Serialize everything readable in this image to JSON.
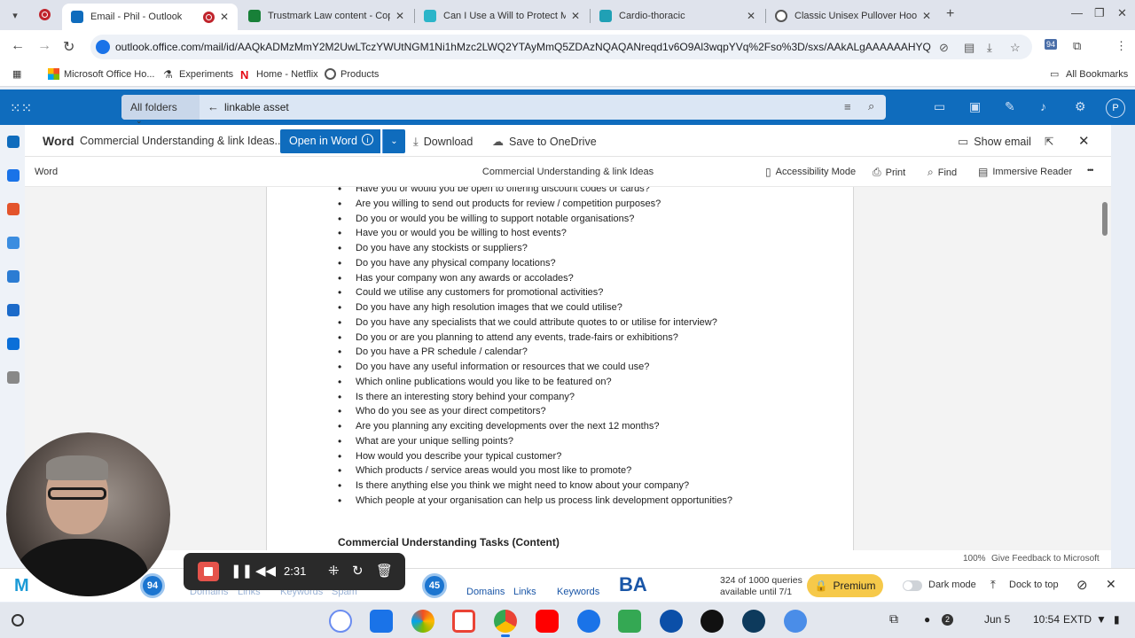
{
  "browser": {
    "tabs": [
      {
        "title": "Email - Phil - Outlook",
        "active": true
      },
      {
        "title": "Trustmark Law content - Copy"
      },
      {
        "title": "Can I Use a Will to Protect My E"
      },
      {
        "title": "Cardio-thoracic"
      },
      {
        "title": "Classic Unisex Pullover Hoodie"
      }
    ],
    "url": "outlook.office.com/mail/id/AAQkADMzMmY2M2UwLTczYWUtNGM1Ni1hMzc2LWQ2YTAyMmQ5ZDAzNQAQANreqd1v6O9Al3wqpYVq%2Fso%3D/sxs/AAkALgAAAAAAHYQDEa...",
    "extension_badge": "94",
    "bookmarks": [
      "Microsoft Office Ho...",
      "Experiments",
      "Home - Netflix",
      "Products"
    ],
    "all_bookmarks": "All Bookmarks"
  },
  "outlook": {
    "folder_scope": "All folders",
    "search_query": "linkable asset",
    "avatar_initial": "P"
  },
  "word": {
    "app_name": "Word",
    "doc_title": "Commercial Understanding & link Ideas....",
    "open_in_word": "Open in Word",
    "download": "Download",
    "save_onedrive": "Save to OneDrive",
    "show_email": "Show email",
    "sub_app": "Word",
    "sub_title": "Commercial Understanding & link Ideas",
    "accessibility": "Accessibility Mode",
    "print": "Print",
    "find": "Find",
    "immersive": "Immersive Reader",
    "more": "•••",
    "questions": [
      "Have you or would you be open to offering discount codes or cards?",
      "Are you willing to send out products for review / competition purposes?",
      "Do you or would you be willing to support notable organisations?",
      "Have you or would you be willing to host events?",
      "Do you have any stockists or suppliers?",
      "Do you have any physical company locations?",
      "Has your company won any awards or accolades?",
      "Could we utilise any customers for promotional activities?",
      "Do you have any high resolution images that we could utilise?",
      "Do you have any specialists that we could attribute quotes to or utilise for interview?",
      "Do you or are you planning to attend any events, trade-fairs or exhibitions?",
      "Do you have a PR schedule / calendar?",
      "Do you have any useful information or resources that we could use?",
      "Which online publications would you like to be featured on?",
      "Is there an interesting story behind your company?",
      "Who do you see as your direct competitors?",
      "Are you planning any exciting developments over the next 12 months?",
      "What are your unique selling points?",
      "How would you describe your typical customer?",
      "Which products / service areas would you most like to promote?",
      "Is there anything else you think we might need to know about your company?",
      "Which people at your organisation can help us process link development opportunities?"
    ],
    "section_heading": "Commercial Understanding Tasks (Content)",
    "zoom": "100%",
    "feedback": "Give Feedback to Microsoft"
  },
  "extension_bar": {
    "score_left": "94",
    "labels_faded": [
      "Domains",
      "Links",
      "Keywords",
      "Spam"
    ],
    "score_right": "45",
    "labels": [
      "Domains",
      "Links",
      "Keywords"
    ],
    "ba": "BA",
    "queries_line1": "324 of 1000 queries",
    "queries_line2": "available until 7/1",
    "premium": "Premium",
    "dark_mode": "Dark mode",
    "dock": "Dock to top"
  },
  "recorder": {
    "time": "2:31"
  },
  "shelf": {
    "notif_count": "2",
    "date": "Jun 5",
    "time": "10:54",
    "tz": "EXTD"
  },
  "colors": {
    "outlook_blue": "#0f6cbd",
    "record_red": "#e5534b",
    "premium_yellow": "#f6c94a"
  }
}
